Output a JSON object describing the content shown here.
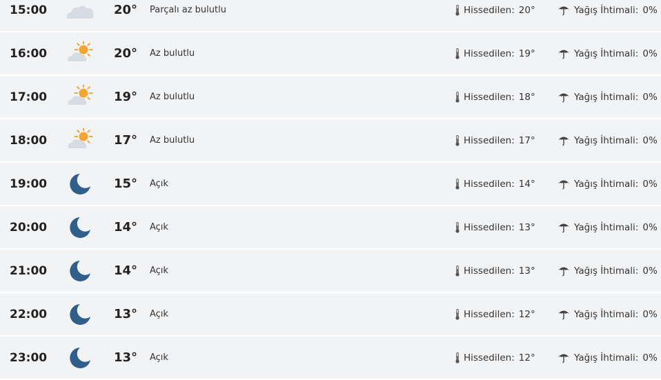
{
  "labels": {
    "feels_like": "Hissedilen:",
    "rain_chance": "Yağış İhtimali:"
  },
  "colors": {
    "moon": "#2f5f8a",
    "sun": "#f3a531",
    "cloud": "#d5dde3"
  },
  "hours": [
    {
      "time": "15:00",
      "icon": "partly-cloudy-icon",
      "temp": "20°",
      "desc": "Parçalı az bulutlu",
      "feels": "20°",
      "rain": "0%"
    },
    {
      "time": "16:00",
      "icon": "sun-cloud-icon",
      "temp": "20°",
      "desc": "Az bulutlu",
      "feels": "19°",
      "rain": "0%"
    },
    {
      "time": "17:00",
      "icon": "sun-cloud-icon",
      "temp": "19°",
      "desc": "Az bulutlu",
      "feels": "18°",
      "rain": "0%"
    },
    {
      "time": "18:00",
      "icon": "sun-cloud-icon",
      "temp": "17°",
      "desc": "Az bulutlu",
      "feels": "17°",
      "rain": "0%"
    },
    {
      "time": "19:00",
      "icon": "moon-icon",
      "temp": "15°",
      "desc": "Açık",
      "feels": "14°",
      "rain": "0%"
    },
    {
      "time": "20:00",
      "icon": "moon-icon",
      "temp": "14°",
      "desc": "Açık",
      "feels": "13°",
      "rain": "0%"
    },
    {
      "time": "21:00",
      "icon": "moon-icon",
      "temp": "14°",
      "desc": "Açık",
      "feels": "13°",
      "rain": "0%"
    },
    {
      "time": "22:00",
      "icon": "moon-icon",
      "temp": "13°",
      "desc": "Açık",
      "feels": "12°",
      "rain": "0%"
    },
    {
      "time": "23:00",
      "icon": "moon-icon",
      "temp": "13°",
      "desc": "Açık",
      "feels": "12°",
      "rain": "0%"
    }
  ]
}
